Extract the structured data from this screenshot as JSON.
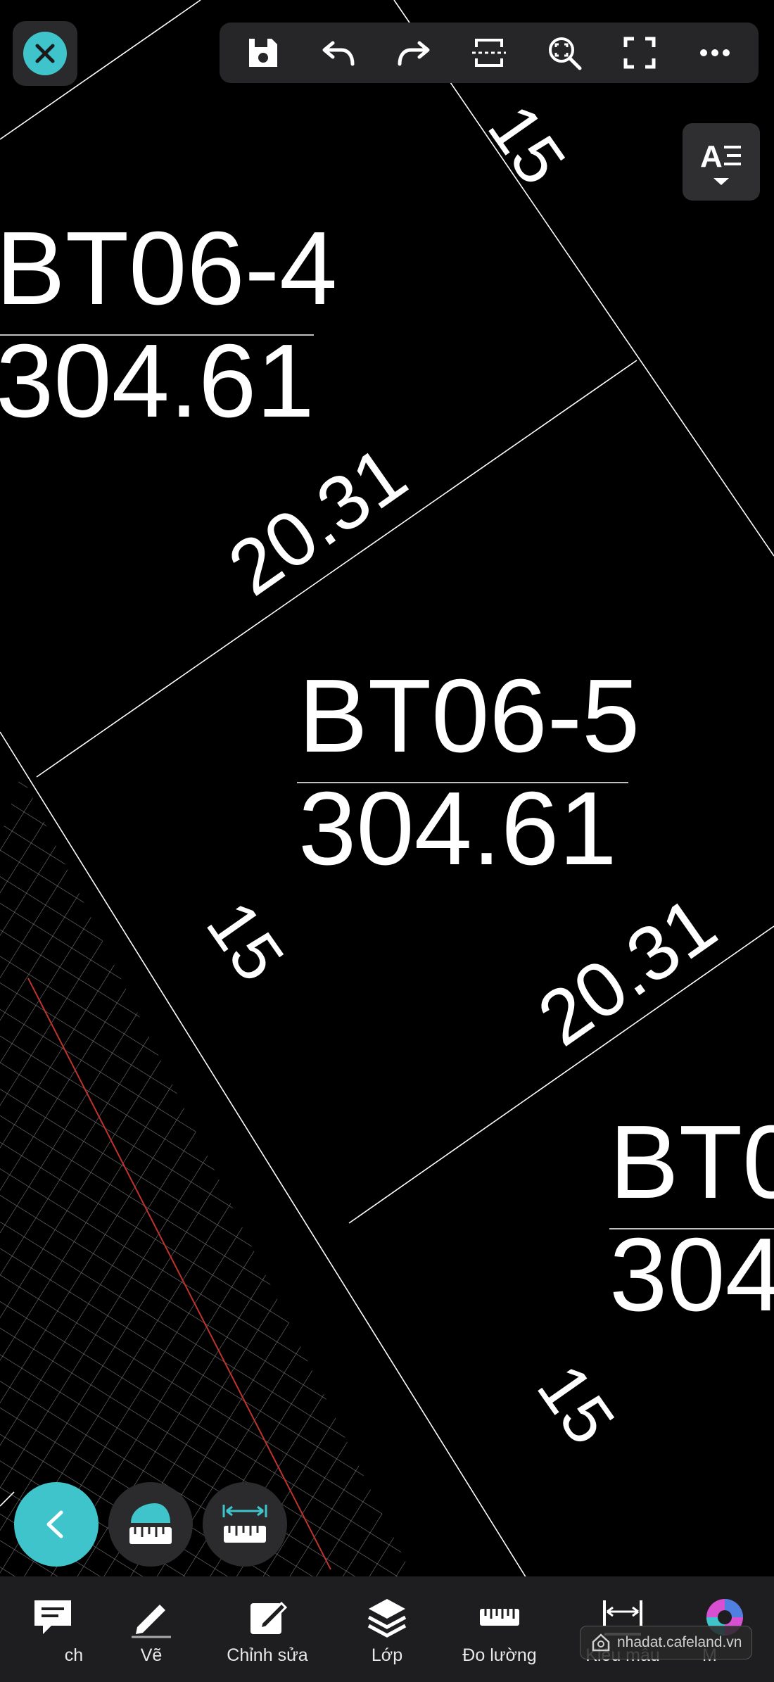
{
  "drawing": {
    "colors": {
      "background": "#000000",
      "lines": "#ffffff",
      "grid": "#8a8a8a",
      "red_line": "#c0332b"
    },
    "lots": [
      {
        "id_label": "BT06-4",
        "area": "304.61"
      },
      {
        "id_label": "BT06-5",
        "area": "304.61"
      },
      {
        "id_label": "BT0",
        "area": "304"
      }
    ],
    "dimensions": {
      "top_right_edge": "15",
      "upper_boundary": "20.31",
      "left_edge_bt06_5": "15",
      "lower_boundary": "20.31",
      "bottom_right_edge": "15"
    }
  },
  "toolbar": {
    "accent": "#3fc4cc",
    "close_icon": "close-icon",
    "items": [
      {
        "icon": "save-icon"
      },
      {
        "icon": "undo-icon"
      },
      {
        "icon": "redo-icon"
      },
      {
        "icon": "section-icon"
      },
      {
        "icon": "zoom-extents-icon"
      },
      {
        "icon": "fullscreen-icon"
      },
      {
        "icon": "more-icon"
      }
    ],
    "text_style_icon": "text-style-icon"
  },
  "floating": {
    "back_icon": "chevron-left-icon",
    "tools": [
      {
        "icon": "area-ruler-icon"
      },
      {
        "icon": "distance-ruler-icon"
      }
    ]
  },
  "bottom_tabs": [
    {
      "label": "ch",
      "icon": "comment-icon"
    },
    {
      "label": "Vẽ",
      "icon": "pencil-icon"
    },
    {
      "label": "Chỉnh sửa",
      "icon": "edit-icon"
    },
    {
      "label": "Lớp",
      "icon": "layers-icon"
    },
    {
      "label": "Đo lường",
      "icon": "ruler-icon"
    },
    {
      "label": "Kiểu mẫu",
      "icon": "dimension-icon"
    },
    {
      "label": "M",
      "icon": "color-wheel-icon"
    }
  ],
  "watermark": {
    "text": "nhadat.cafeland.vn"
  }
}
